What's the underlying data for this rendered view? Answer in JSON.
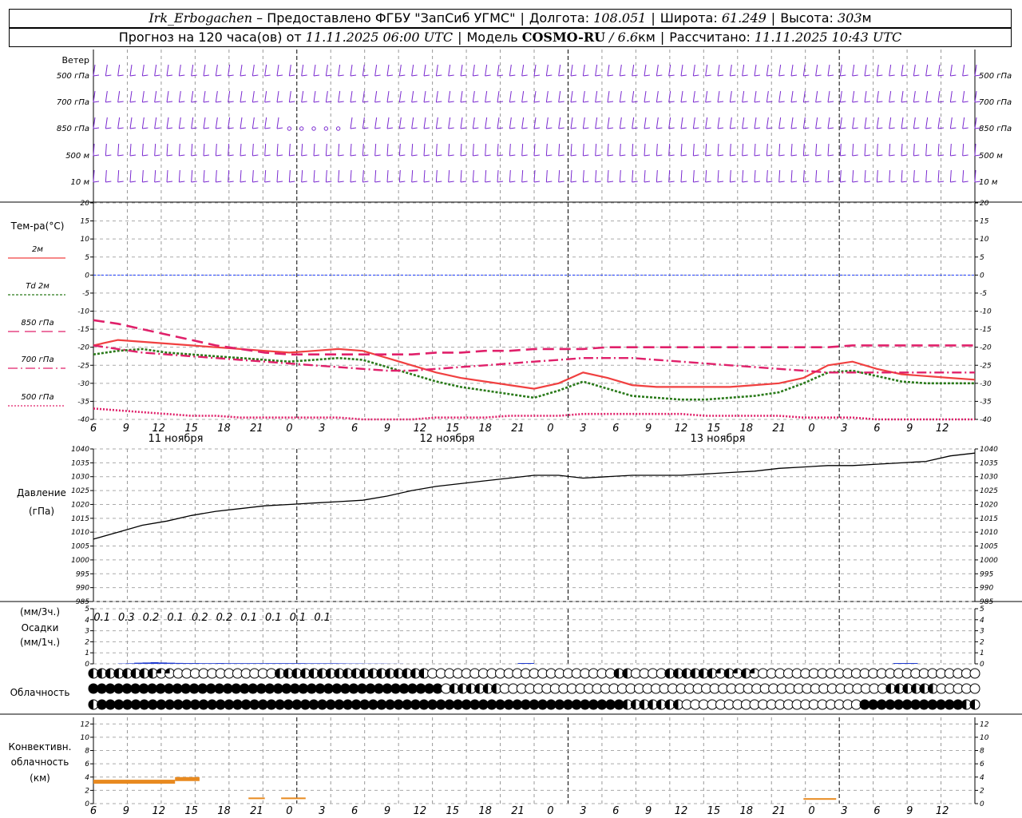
{
  "header": {
    "station": "Irk_Erbogachen",
    "provider": "– Предоставлено ФГБУ \"ЗапСиб УГМС\"",
    "lon_label": "Долгота:",
    "lon_value": "108.051",
    "lat_label": "Широта:",
    "lat_value": "61.249",
    "alt_label": "Высота:",
    "alt_value": "303",
    "alt_unit": "м",
    "forecast_text": "Прогноз на 120 часа(ов) от",
    "forecast_time": "11.11.2025 06:00 UTC",
    "model_label": "Модель",
    "model_name": "COSMO-RU",
    "model_res": "/ 6.6",
    "model_res_unit": "км",
    "calc_label": "Рассчитано:",
    "calc_time": "11.11.2025 10:43 UTC"
  },
  "colors": {
    "t2m": "#f04040",
    "td2m": "#2a7a1a",
    "t850": "#e0206a",
    "t700": "#e0206a",
    "t500": "#e0206a",
    "wind": "#7a2ad0",
    "pressure": "#000000",
    "precip": "#1f3ad0",
    "convective": "#e88a20",
    "zero_line": "#2040ff"
  },
  "time_axis": {
    "ticks": [
      "6",
      "9",
      "12",
      "15",
      "18",
      "21",
      "0",
      "3",
      "6",
      "9",
      "12",
      "15",
      "18",
      "21",
      "0",
      "3",
      "6",
      "9",
      "12",
      "15",
      "18",
      "21",
      "0",
      "3",
      "6",
      "9",
      "12"
    ],
    "day_labels": [
      "11 ноября",
      "12 ноября",
      "13 ноября"
    ]
  },
  "wind_panel": {
    "title": "Ветер",
    "levels": [
      "500 гПа",
      "700 гПа",
      "850 гПа",
      "500 м",
      "10 м"
    ]
  },
  "chart_data": [
    {
      "type": "line",
      "title": "Тем-ра(°C)",
      "ylim": [
        -40,
        20
      ],
      "yticks": [
        "20",
        "15",
        "10",
        "5",
        "0",
        "-5",
        "-10",
        "-15",
        "-20",
        "-25",
        "-30",
        "-35",
        "-40"
      ],
      "x_hours": [
        0,
        3,
        6,
        9,
        12,
        15,
        18,
        21,
        24,
        27,
        30,
        33,
        36,
        39,
        42,
        45,
        48,
        51,
        54,
        57,
        60,
        63,
        66,
        69,
        72,
        75,
        78,
        81,
        84,
        87,
        90,
        93,
        96,
        99,
        102,
        105,
        108
      ],
      "series": [
        {
          "name": "2м",
          "values": [
            -19.5,
            -18,
            -18.5,
            -19,
            -19.5,
            -20,
            -20.5,
            -21,
            -21.5,
            -21,
            -20.5,
            -21,
            -23,
            -25,
            -27,
            -28.5,
            -29.5,
            -30.5,
            -31.5,
            -30,
            -27,
            -28.5,
            -30.5,
            -31,
            -31,
            -31,
            -31,
            -30.5,
            -30,
            -28.5,
            -25,
            -24,
            -26,
            -27.5,
            -28,
            -28.5,
            -29
          ]
        },
        {
          "name": "Td 2м",
          "values": [
            -22,
            -21,
            -20.5,
            -21.5,
            -22,
            -22.5,
            -23,
            -23.5,
            -24,
            -23.5,
            -23,
            -23.5,
            -25.5,
            -27.5,
            -29.5,
            -31,
            -32,
            -33,
            -34,
            -32,
            -29.5,
            -31.5,
            -33.5,
            -34,
            -34.5,
            -34.5,
            -34,
            -33.5,
            -32.5,
            -30,
            -27,
            -26.5,
            -28,
            -29.5,
            -30,
            -30,
            -30
          ]
        },
        {
          "name": "850 гПа",
          "values": [
            -12.5,
            -13.5,
            -15,
            -16.5,
            -18,
            -19.5,
            -20.5,
            -21.5,
            -22,
            -22,
            -22,
            -22,
            -22,
            -22,
            -21.5,
            -21.5,
            -21,
            -21,
            -20.5,
            -20.5,
            -20.5,
            -20,
            -20,
            -20,
            -20,
            -20,
            -20,
            -20,
            -20,
            -20,
            -20,
            -19.5,
            -19.5,
            -19.5,
            -19.5,
            -19.5,
            -19.5
          ]
        },
        {
          "name": "700 гПа",
          "values": [
            -19.5,
            -20.5,
            -21.5,
            -22,
            -22.5,
            -23,
            -23.5,
            -24,
            -24.5,
            -25,
            -25.5,
            -26,
            -26.5,
            -26.5,
            -26,
            -25.5,
            -25,
            -24.5,
            -24,
            -23.5,
            -23,
            -23,
            -23,
            -23.5,
            -24,
            -24.5,
            -25,
            -25.5,
            -26,
            -26.5,
            -27,
            -27,
            -27,
            -27,
            -27,
            -27,
            -27
          ]
        },
        {
          "name": "500 гПа",
          "values": [
            -37,
            -37.5,
            -38,
            -38.5,
            -39,
            -39,
            -39.5,
            -39.5,
            -39.5,
            -39.5,
            -39.5,
            -40,
            -40,
            -40,
            -39.5,
            -39.5,
            -39.5,
            -39,
            -39,
            -39,
            -38.5,
            -38.5,
            -38.5,
            -38.5,
            -38.5,
            -39,
            -39,
            -39,
            -39,
            -39.5,
            -39.5,
            -39.5,
            -40,
            -40,
            -40,
            -40,
            -40
          ]
        }
      ]
    },
    {
      "type": "line",
      "title": "Давление",
      "ylabel": "(гПа)",
      "ylim": [
        985,
        1040
      ],
      "yticks": [
        "1040",
        "1035",
        "1030",
        "1025",
        "1020",
        "1015",
        "1010",
        "1005",
        "1000",
        "995",
        "990",
        "985"
      ],
      "x_hours": [
        0,
        3,
        6,
        9,
        12,
        15,
        18,
        21,
        24,
        27,
        30,
        33,
        36,
        39,
        42,
        45,
        48,
        51,
        54,
        57,
        60,
        63,
        66,
        69,
        72,
        75,
        78,
        81,
        84,
        87,
        90,
        93,
        96,
        99,
        102,
        105,
        108
      ],
      "series": [
        {
          "name": "",
          "values": [
            1007.5,
            1010,
            1012.5,
            1014,
            1016,
            1017.5,
            1018.5,
            1019.5,
            1020,
            1020.5,
            1021,
            1021.5,
            1023,
            1025,
            1026.5,
            1027.5,
            1028.5,
            1029.5,
            1030.5,
            1030.5,
            1029.5,
            1030,
            1030.5,
            1030.5,
            1030.5,
            1031,
            1031.5,
            1032,
            1033,
            1033.5,
            1034,
            1034,
            1034.5,
            1035,
            1035.5,
            1037.5,
            1038.5
          ]
        }
      ]
    },
    {
      "type": "bar",
      "title": "Осадки",
      "ylabel": "(мм/3ч.) (мм/1ч.)",
      "ylim": [
        0,
        5
      ],
      "yticks": [
        "5",
        "4",
        "3",
        "2",
        "1",
        "0"
      ],
      "labels": [
        "0.1",
        "0.3",
        "0.2",
        "0.1",
        "0.2",
        "0.2",
        "0.1",
        "0.1",
        "0.1",
        "0.1"
      ],
      "label_hours": [
        3,
        6,
        9,
        12,
        15,
        18,
        21,
        24,
        27,
        30
      ],
      "hourly_hours": [
        4,
        5,
        6,
        7,
        8,
        9,
        10,
        11,
        12,
        13,
        14,
        15,
        16,
        17,
        18,
        19,
        20,
        21,
        22,
        23,
        24,
        25,
        26,
        27,
        28,
        29,
        30,
        31,
        32,
        33,
        34,
        35,
        36,
        37,
        38,
        39,
        40,
        41,
        42,
        43,
        44,
        45,
        46,
        47,
        48,
        49,
        50,
        51,
        52,
        53,
        54,
        55,
        56,
        57,
        58,
        59,
        60,
        61,
        62,
        63,
        64,
        65,
        66,
        67,
        68,
        69,
        70,
        71,
        72,
        73,
        74,
        75,
        76,
        77,
        78,
        79,
        80,
        81,
        82,
        83,
        84,
        85,
        86,
        87,
        88,
        89,
        90,
        91,
        92,
        93,
        94,
        95,
        96,
        97,
        98,
        99,
        100,
        101,
        102,
        103,
        104,
        105,
        106,
        107,
        108
      ],
      "hourly_values": [
        0.03,
        0.05,
        0.1,
        0.12,
        0.15,
        0.12,
        0.1,
        0.08,
        0.07,
        0.07,
        0.06,
        0.06,
        0.07,
        0.06,
        0.06,
        0.06,
        0.06,
        0.06,
        0.06,
        0.06,
        0.06,
        0.06,
        0.06,
        0.05,
        0.05,
        0.05,
        0.05,
        0.04,
        0.03,
        0.03,
        0.02,
        0.02,
        0.02,
        0.01,
        0.01,
        0,
        0,
        0,
        0,
        0,
        0,
        0,
        0,
        0,
        0,
        0,
        0,
        0,
        0,
        0,
        0,
        0,
        0,
        0,
        0,
        0,
        0,
        0,
        0,
        0,
        0,
        0,
        0,
        0,
        0,
        0,
        0,
        0,
        0,
        0,
        0,
        0,
        0,
        0,
        0,
        0,
        0,
        0,
        0,
        0,
        0,
        0,
        0,
        0,
        0,
        0,
        0,
        0,
        0,
        0,
        0,
        0,
        0,
        0,
        0,
        0,
        0,
        0,
        0,
        0,
        0,
        0,
        0,
        0,
        0
      ]
    },
    {
      "type": "table",
      "title": "Облачность",
      "rows": [
        {
          "name": "upper",
          "values": "HHHHHHHHCCOOOOOOOOOOOOHHHHHHHHHHHHHHHHHHOOOOOOOOOOOOOOOOOOOOOOHHOOOOHHHHHHCHCHCOOOOOOOOOOOOOOOOOOOOOOOOOO"
        },
        {
          "name": "middle",
          "values": "FFFFFFFFFFFFFFFFFFFFFFFFFFFFFFFFFFFFFFFFFFOHHHHHHOOOOOOOOOOOOOOOOOOOOOOOOOOOOOOOOOOOOOOOOOOOOOOHHHHHHOOOOO"
        },
        {
          "name": "lower",
          "values": "HFFFFFFFFFFFFFFFFFFFFFFFFFFFFFFFFFFFFFFFFFFFFFFFFFFFFFFFFFFFFFFHHHHHHHOOOOOOOOOOOOOOOOOOOOOFFFFFFFFFFFFHH"
        }
      ]
    },
    {
      "type": "bar",
      "title": "Конвективн. облачность",
      "ylabel": "(км)",
      "ylim": [
        0,
        13
      ],
      "yticks": [
        "12",
        "10",
        "8",
        "6",
        "4",
        "2",
        "0"
      ],
      "segments": [
        {
          "start_hour": 0,
          "end_hour": 10,
          "value": 3.3
        },
        {
          "start_hour": 10,
          "end_hour": 13,
          "value": 3.7
        },
        {
          "start_hour": 19,
          "end_hour": 21,
          "value": 0.8
        },
        {
          "start_hour": 23,
          "end_hour": 26,
          "value": 0.8
        },
        {
          "start_hour": 87,
          "end_hour": 91,
          "value": 0.7
        }
      ]
    }
  ]
}
